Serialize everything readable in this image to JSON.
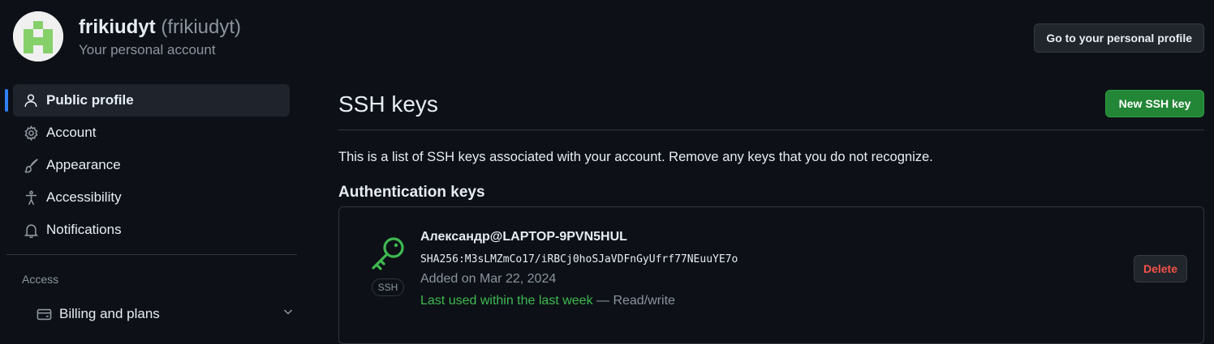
{
  "header": {
    "username": "frikiudyt",
    "handle": "(frikiudyt)",
    "subtitle": "Your personal account",
    "profile_button": "Go to your personal profile"
  },
  "sidebar": {
    "items": [
      {
        "label": "Public profile",
        "icon": "person-icon",
        "active": true
      },
      {
        "label": "Account",
        "icon": "gear-icon"
      },
      {
        "label": "Appearance",
        "icon": "paintbrush-icon"
      },
      {
        "label": "Accessibility",
        "icon": "accessibility-icon"
      },
      {
        "label": "Notifications",
        "icon": "bell-icon"
      }
    ],
    "section_access": "Access",
    "billing": {
      "label": "Billing and plans",
      "icon": "credit-card-icon"
    }
  },
  "main": {
    "title": "SSH keys",
    "new_key_button": "New SSH key",
    "description": "This is a list of SSH keys associated with your account. Remove any keys that you do not recognize.",
    "auth_heading": "Authentication keys",
    "keys": [
      {
        "title": "Александр@LAPTOP-9PVN5HUL",
        "fingerprint": "SHA256:M3sLMZmCo17/iRBCj0hoSJaVDFnGyUfrf77NEuuYE7o",
        "added": "Added on Mar 22, 2024",
        "last_used": "Last used within the last week",
        "access": " — Read/write",
        "type_label": "SSH",
        "delete_label": "Delete"
      }
    ]
  },
  "colors": {
    "background": "#0d1117",
    "accent_blue": "#2f81f7",
    "success_green": "#238636",
    "key_icon_green": "#3fb950",
    "danger_red": "#f85149"
  }
}
